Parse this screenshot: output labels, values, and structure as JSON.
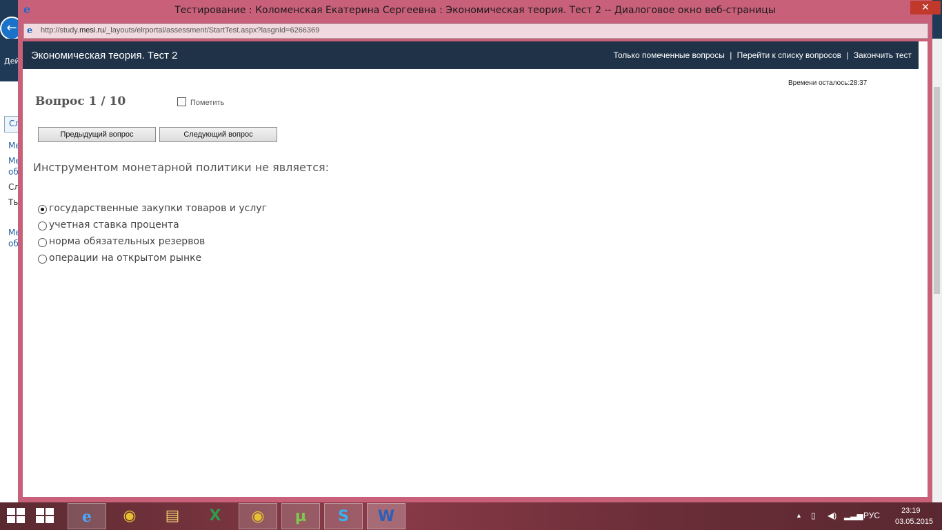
{
  "window": {
    "title": "Тестирование : Коломенская Екатерина Сергеевна : Экономическая теория. Тест 2 -- Диалоговое окно веб-страницы",
    "close_label": "✕",
    "url_prefix": "http://study.",
    "url_host": "mesi.ru",
    "url_suffix": "/_layouts/elrportal/assessment/StartTest.aspx?lasgnId=6266369"
  },
  "background_page": {
    "nav_label": "Дей",
    "tab_label": "Сл",
    "side_items": [
      "Ме",
      "Ме",
      "об",
      "Сл",
      "Ты",
      "Ме",
      "об"
    ]
  },
  "header": {
    "title": "Экономическая теория. Тест 2",
    "links": [
      "Только помеченные вопросы",
      "Перейти к списку вопросов",
      "Закончить тест"
    ],
    "separator": "|"
  },
  "timer": {
    "label": "Времени осталось:",
    "value": "28:37"
  },
  "question": {
    "number_label": "Вопрос 1 / 10",
    "mark_label": "Пометить",
    "mark_checked": false,
    "text": "Инструментом монетарной политики не является:",
    "answers": [
      {
        "label": "государственные закупки товаров и услуг",
        "selected": true
      },
      {
        "label": "учетная ставка процента",
        "selected": false
      },
      {
        "label": "норма обязательных резервов",
        "selected": false
      },
      {
        "label": "операции на открытом рынке",
        "selected": false
      }
    ]
  },
  "buttons": {
    "prev_label": "Предыдущий вопрос",
    "next_label": "Следующий вопрос"
  },
  "taskbar": {
    "apps": [
      {
        "name": "internet-explorer",
        "glyph": "e",
        "active": true
      },
      {
        "name": "chrome",
        "glyph": "◉",
        "active": false
      },
      {
        "name": "file-explorer",
        "glyph": "▤",
        "active": false
      },
      {
        "name": "excel",
        "glyph": "X",
        "active": false
      },
      {
        "name": "chrome",
        "glyph": "◉",
        "active": true
      },
      {
        "name": "utorrent",
        "glyph": "µ",
        "active": true
      },
      {
        "name": "skype",
        "glyph": "S",
        "active": true
      },
      {
        "name": "word",
        "glyph": "W",
        "active": true
      }
    ],
    "tray_lang": "РУС",
    "clock_time": "23:19",
    "clock_date": "03.05.2015"
  }
}
